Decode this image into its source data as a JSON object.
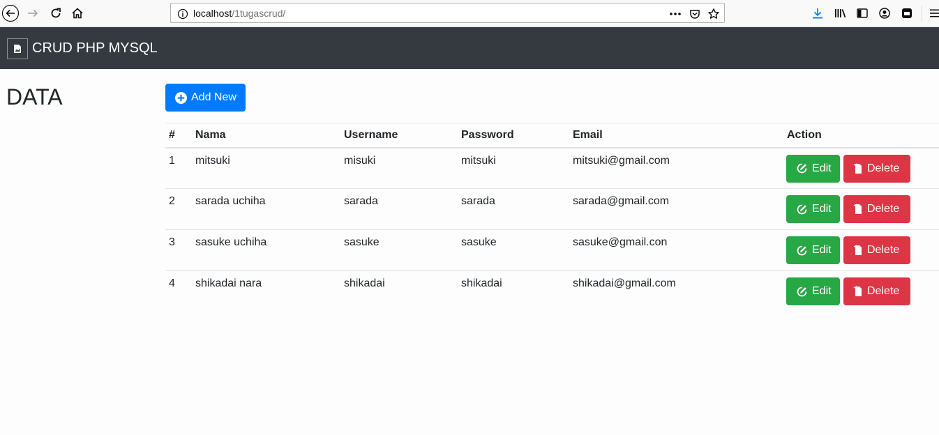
{
  "browser": {
    "url_host": "localhost",
    "url_path": "/1tugascrud/"
  },
  "navbar": {
    "brand": "CRUD PHP MYSQL"
  },
  "page": {
    "title": "DATA",
    "add_button_label": "Add New"
  },
  "table": {
    "headers": [
      "#",
      "Nama",
      "Username",
      "Password",
      "Email",
      "Action"
    ],
    "rows": [
      {
        "no": "1",
        "nama": "mitsuki",
        "username": "misuki",
        "password": "mitsuki",
        "email": "mitsuki@gmail.com"
      },
      {
        "no": "2",
        "nama": "sarada uchiha",
        "username": "sarada",
        "password": "sarada",
        "email": "sarada@gmail.com"
      },
      {
        "no": "3",
        "nama": "sasuke uchiha",
        "username": "sasuke",
        "password": "sasuke",
        "email": "sasuke@gmail.con"
      },
      {
        "no": "4",
        "nama": "shikadai nara",
        "username": "shikadai",
        "password": "shikadai",
        "email": "shikadai@gmail.com"
      }
    ],
    "edit_label": "Edit",
    "delete_label": "Delete"
  },
  "colors": {
    "navbar": "#343a40",
    "primary": "#007bff",
    "success": "#28a745",
    "danger": "#dc3545"
  }
}
